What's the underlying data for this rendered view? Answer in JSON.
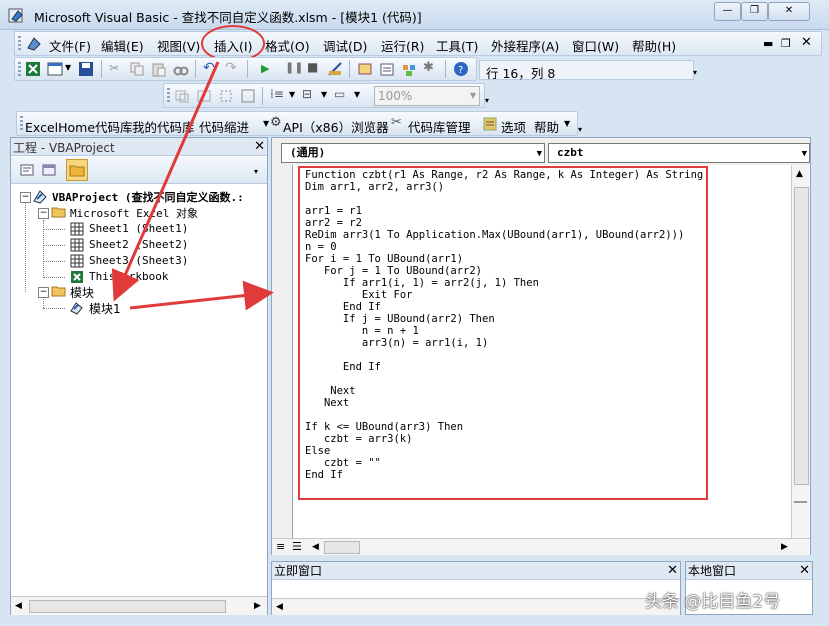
{
  "window": {
    "title": "Microsoft Visual Basic - 查找不同自定义函数.xlsm - [模块1 (代码)]"
  },
  "menu": {
    "items": [
      "文件(F)",
      "编辑(E)",
      "视图(V)",
      "插入(I)",
      "格式(O)",
      "调试(D)",
      "运行(R)",
      "工具(T)",
      "外接程序(A)",
      "窗口(W)",
      "帮助(H)"
    ]
  },
  "toolbar": {
    "position": "行 16，列 8",
    "zoom": "100%"
  },
  "excelhome_bar": {
    "items": [
      "ExcelHome代码库",
      "我的代码库",
      "代码缩进",
      "API（x86）浏览器",
      "代码库管理",
      "选项",
      "帮助"
    ]
  },
  "project": {
    "title": "工程 - VBAProject",
    "root": "VBAProject (查找不同自定义函数.:",
    "excel_objects": "Microsoft Excel 对象",
    "sheets": [
      "Sheet1 (Sheet1)",
      "Sheet2 (Sheet2)",
      "Sheet3 (Sheet3)",
      "ThisWorkbook"
    ],
    "modules_folder": "模块",
    "module": "模块1"
  },
  "code": {
    "object_combo": "(通用)",
    "proc_combo": "czbt",
    "text": "Function czbt(r1 As Range, r2 As Range, k As Integer) As String\nDim arr1, arr2, arr3()\n\narr1 = r1\narr2 = r2\nReDim arr3(1 To Application.Max(UBound(arr1), UBound(arr2)))\nn = 0\nFor i = 1 To UBound(arr1)\n   For j = 1 To UBound(arr2)\n      If arr1(i, 1) = arr2(j, 1) Then\n         Exit For\n      End If\n      If j = UBound(arr2) Then\n         n = n + 1\n         arr3(n) = arr1(i, 1)\n\n      End If\n\n    Next\n   Next\n\nIf k <= UBound(arr3) Then\n   czbt = arr3(k)\nElse\n   czbt = \"\"\nEnd If"
  },
  "immediate": {
    "title": "立即窗口"
  },
  "locals": {
    "title": "本地窗口"
  },
  "watermark": "头条 @比目鱼2号",
  "colors": {
    "annotation_red": "#e13a3a",
    "window_bg": "#d7e4f2"
  }
}
